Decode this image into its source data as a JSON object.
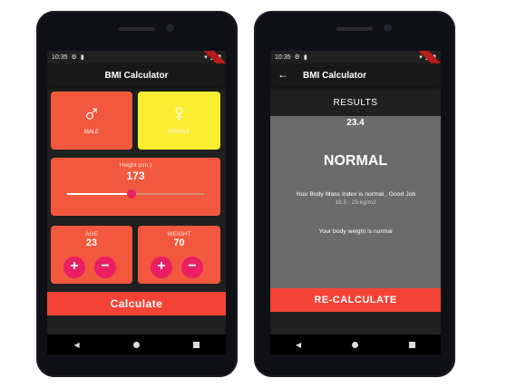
{
  "left_phone": {
    "status_time": "10:35",
    "app_title": "BMI Calculator",
    "male": {
      "label": "MALE",
      "icon": "male-icon"
    },
    "female": {
      "label": "FEMALE",
      "icon": "female-icon"
    },
    "height": {
      "label": "Height (cm.)",
      "value": "173",
      "slider_fraction": 0.47
    },
    "age": {
      "label": "AGE",
      "value": "23"
    },
    "weight": {
      "label": "WEIGHT",
      "value": "70"
    },
    "plus_label": "+",
    "minus_label": "−",
    "calculate_label": "Calculate"
  },
  "right_phone": {
    "status_time": "10:35",
    "app_title": "BMI Calculator",
    "results_title": "RESULTS",
    "bmi_value": "23.4",
    "status": "NORMAL",
    "interpretation": "Your Body Mass Index is normal , Good Job",
    "range": "18.5 - 25 kg/m2",
    "weight_note": "Your body weight is normal",
    "recalculate_label": "RE-CALCULATE"
  },
  "colors": {
    "card": "#f2583e",
    "female_card": "#fbed2f",
    "accent": "#e91e63",
    "button": "#f44336",
    "background": "#202020"
  }
}
